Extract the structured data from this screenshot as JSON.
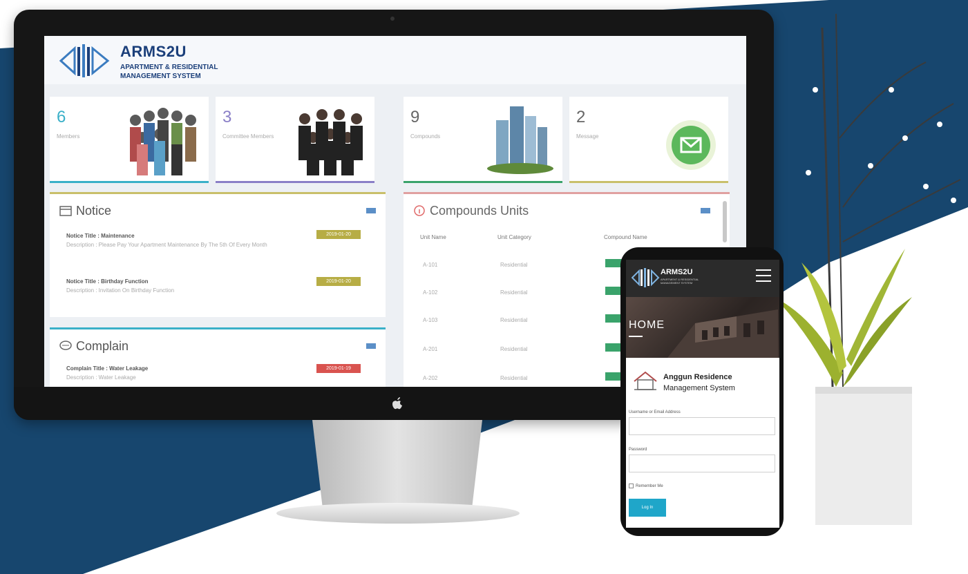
{
  "dashboard": {
    "brand": {
      "title": "ARMS2U",
      "subtitle_line1": "APARTMENT & RESIDENTIAL",
      "subtitle_line2": "MANAGEMENT SYSTEM"
    },
    "stats": [
      {
        "value": "6",
        "label": "Members",
        "icon": "people-group-image"
      },
      {
        "value": "3",
        "label": "Committee Members",
        "icon": "committee-group-image"
      },
      {
        "value": "9",
        "label": "Compounds",
        "icon": "buildings-image"
      },
      {
        "value": "2",
        "label": "Message",
        "icon": "envelope-icon"
      }
    ],
    "notice": {
      "title": "Notice",
      "items": [
        {
          "title": "Notice Title : Maintenance",
          "description": "Description : Please Pay Your Apartment Maintenance By The 5th Of Every Month",
          "badge": "2019-01-20"
        },
        {
          "title": "Notice Title : Birthday Function",
          "description": "Description : Invitation On Birthday Function",
          "badge": "2019-01-20"
        }
      ]
    },
    "complain": {
      "title": "Complain",
      "items": [
        {
          "title": "Complain Title : Water Leakage",
          "description": "Description : Water Leakage",
          "badge": "2019-01-19"
        }
      ]
    },
    "compounds": {
      "title": "Compounds Units",
      "columns": [
        "Unit Name",
        "Unit Category",
        "Compound Name"
      ],
      "rows": [
        [
          "A-101",
          "Residential"
        ],
        [
          "A-102",
          "Residential"
        ],
        [
          "A-103",
          "Residential"
        ],
        [
          "A-201",
          "Residential"
        ],
        [
          "A-202",
          "Residential"
        ]
      ]
    }
  },
  "mobile": {
    "brand": "ARMS2U",
    "brand_sub": "APARTMENT & RESIDENTIAL MANAGEMENT SYSTEM",
    "hero_title": "HOME",
    "org_line1": "Anggun Residence",
    "org_line2": "Management System",
    "username_label": "Username or Email Address",
    "password_label": "Password",
    "remember_label": "Remember Me",
    "login_button": "Log In"
  },
  "colors": {
    "brand_navy": "#1b3f7a",
    "background_blue": "#17466e",
    "accent_teal": "#1fa6c9",
    "notice_badge": "#b7ad45",
    "complain_badge": "#d9534f",
    "status_green": "#3aa36b"
  }
}
